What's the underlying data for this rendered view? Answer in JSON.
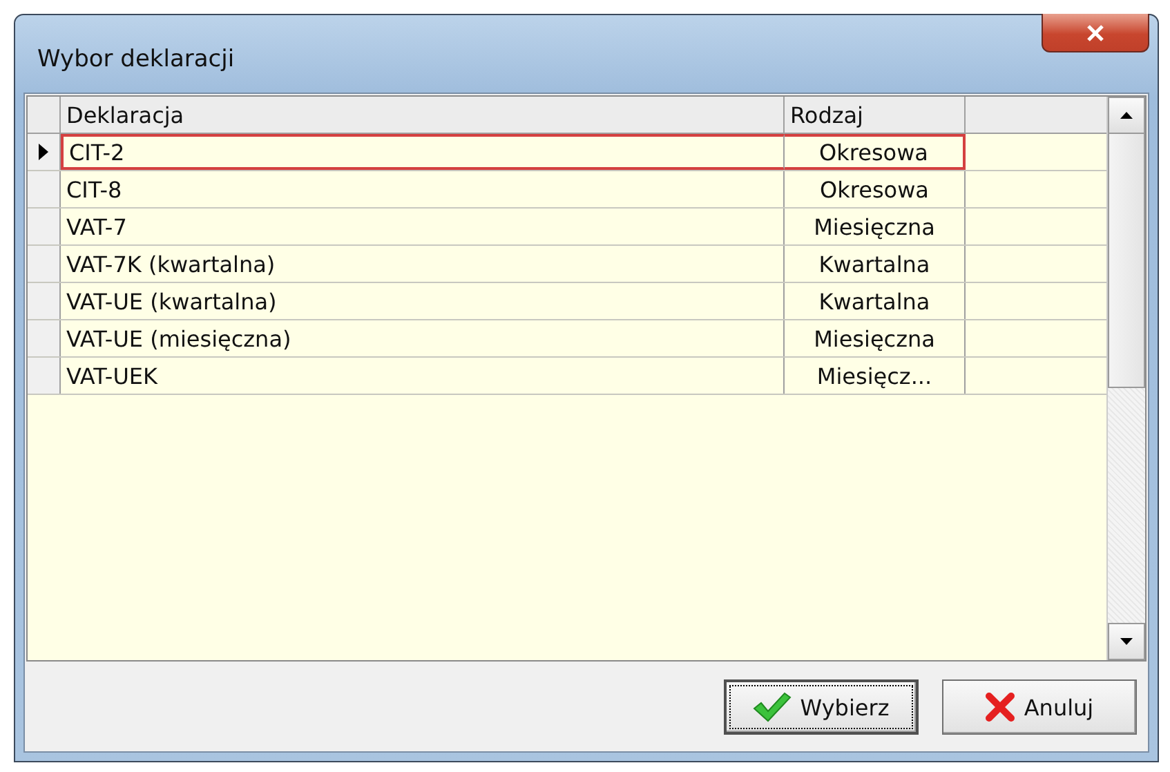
{
  "window": {
    "title": "Wybor deklaracji"
  },
  "table": {
    "columns": [
      "Deklaracja",
      "Rodzaj"
    ],
    "rows": [
      {
        "cells": [
          "CIT-2",
          "Okresowa"
        ],
        "selected": true
      },
      {
        "cells": [
          "CIT-8",
          "Okresowa"
        ],
        "selected": false
      },
      {
        "cells": [
          "VAT-7",
          "Miesięczna"
        ],
        "selected": false
      },
      {
        "cells": [
          "VAT-7K (kwartalna)",
          "Kwartalna"
        ],
        "selected": false
      },
      {
        "cells": [
          "VAT-UE (kwartalna)",
          "Kwartalna"
        ],
        "selected": false
      },
      {
        "cells": [
          "VAT-UE (miesięczna)",
          "Miesięczna"
        ],
        "selected": false
      },
      {
        "cells": [
          "VAT-UEK",
          "Miesięcz..."
        ],
        "selected": false
      }
    ]
  },
  "buttons": [
    {
      "kind": "ok",
      "label": "Wybierz",
      "focused": true
    },
    {
      "kind": "cancel",
      "label": "Anuluj",
      "focused": false
    }
  ]
}
